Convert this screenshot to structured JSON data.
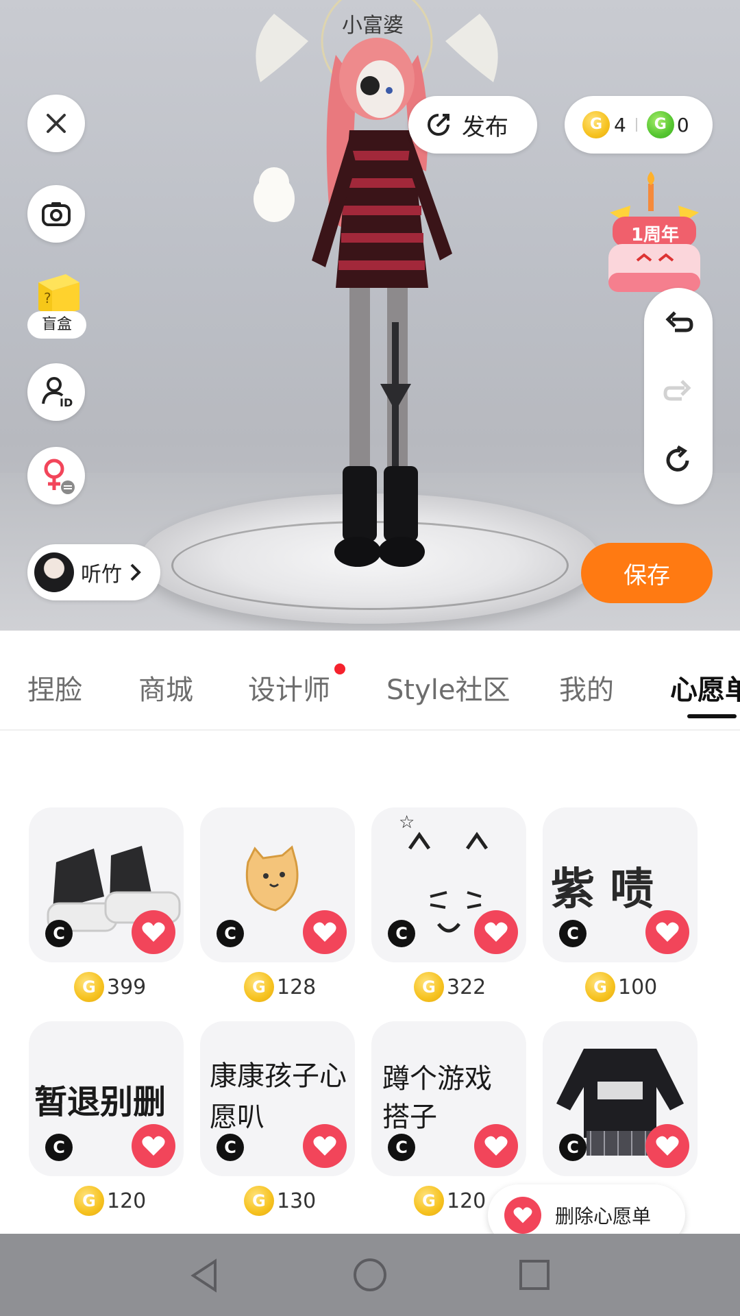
{
  "stage": {
    "halo_text": "小富婆",
    "publish_label": "发布",
    "coins": {
      "gold": "4",
      "green": "0"
    },
    "blind_box_label": "盲盒",
    "anniversary_text": "1周年",
    "save_label": "保存",
    "user_name": "听竹"
  },
  "tabs": [
    {
      "label": "捏脸"
    },
    {
      "label": "商城"
    },
    {
      "label": "设计师"
    },
    {
      "label": "Style社区"
    },
    {
      "label": "我的"
    },
    {
      "label": "心愿单"
    }
  ],
  "items": [
    {
      "price": "399",
      "art": "sneakers"
    },
    {
      "price": "128",
      "art": "cat-toast"
    },
    {
      "price": "322",
      "art": "cat-face"
    },
    {
      "price": "100",
      "text": "紫 啧"
    },
    {
      "price": "120",
      "text": "暂退别删"
    },
    {
      "price": "130",
      "text": "康康孩子心愿叭"
    },
    {
      "price": "120",
      "text": "蹲个游戏搭子"
    },
    {
      "art": "sweater-outfit"
    }
  ],
  "delete_wishlist_label": "删除心愿单",
  "colors": {
    "accent": "#ff7a12",
    "heart": "#f2455a",
    "gold_coin": "#f6c21f",
    "green_coin": "#56c631"
  }
}
